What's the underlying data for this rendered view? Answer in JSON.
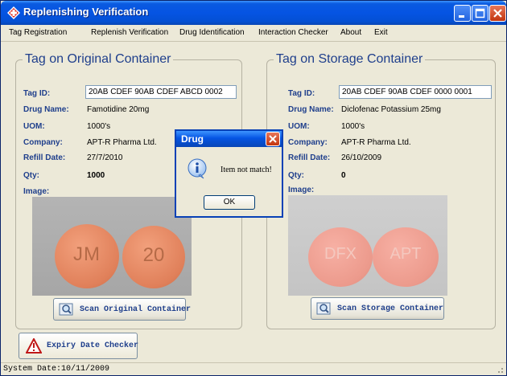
{
  "window": {
    "title": "Replenishing Verification"
  },
  "menu": [
    "Tag Registration",
    "Replenish Verification",
    "Drug Identification",
    "Interaction Checker",
    "About",
    "Exit"
  ],
  "labels": {
    "tag_id": "Tag ID:",
    "drug_name": "Drug Name:",
    "uom": "UOM:",
    "company": "Company:",
    "refill_date": "Refill Date:",
    "qty": "Qty:",
    "image": "Image:"
  },
  "original": {
    "title": "Tag on Original Container",
    "tag_id": "20AB CDEF 90AB CDEF ABCD 0002",
    "drug_name": "Famotidine 20mg",
    "uom": "1000's",
    "company": "APT-R Pharma Ltd.",
    "refill_date": "27/7/2010",
    "qty": "1000",
    "pill_marks": [
      "JM",
      "20"
    ],
    "scan_label": "Scan Original Container"
  },
  "storage": {
    "title": "Tag on Storage Container",
    "tag_id": "20AB CDEF 90AB CDEF 0000 0001",
    "drug_name": "Diclofenac Potassium 25mg",
    "uom": "1000's",
    "company": "APT-R Pharma Ltd.",
    "refill_date": "26/10/2009",
    "qty": "0",
    "pill_marks": [
      "DFX",
      "APT"
    ],
    "scan_label": "Scan Storage Container"
  },
  "dialog": {
    "title": "Drug",
    "message": "Item not match!",
    "ok_label": "OK"
  },
  "expiry": {
    "label": "Expiry Date Checker"
  },
  "status": {
    "text": "System Date:10/11/2009"
  },
  "colors": {
    "title_bar": "#0554e3",
    "label_blue": "#1f3f8c",
    "pill_orange": "#e88e6a",
    "pill_pink": "#ee9f95"
  }
}
